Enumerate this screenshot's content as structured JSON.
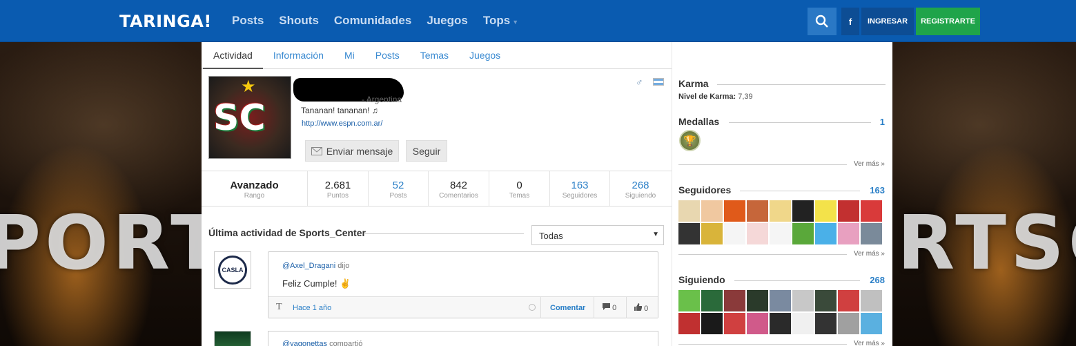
{
  "header": {
    "logo": "TARINGA!",
    "nav": [
      "Posts",
      "Shouts",
      "Comunidades",
      "Juegos",
      "Tops"
    ],
    "facebook_label": "f",
    "login_label": "INGRESAR",
    "register_label": "REGISTRARTE",
    "colors": {
      "bar": "#0a5bb0",
      "register": "#1fa44a"
    }
  },
  "background": {
    "text_left": "PORTS",
    "text_right": "RTSC"
  },
  "profile": {
    "tabs": [
      "Actividad",
      "Información",
      "Mi",
      "Posts",
      "Temas",
      "Juegos"
    ],
    "active_tab": "Actividad",
    "avatar_text": "SC",
    "country": "- Argentina",
    "bio": "Tananan! tananan! ♫",
    "link": "http://www.espn.com.ar/",
    "send_message_label": "Enviar mensaje",
    "follow_label": "Seguir"
  },
  "stats": [
    {
      "value": "Avanzado",
      "label": "Rango"
    },
    {
      "value": "2.681",
      "label": "Puntos"
    },
    {
      "value": "52",
      "label": "Posts"
    },
    {
      "value": "842",
      "label": "Comentarios"
    },
    {
      "value": "0",
      "label": "Temas"
    },
    {
      "value": "163",
      "label": "Seguidores"
    },
    {
      "value": "268",
      "label": "Siguiendo"
    }
  ],
  "activity": {
    "title": "Última actividad de Sports_Center",
    "filter": "Todas",
    "posts": [
      {
        "author": "@Axel_Dragani",
        "verb": "dijo",
        "message": "Feliz Cumple! ✌",
        "avatar_text": "CASLA",
        "time": "Hace 1 año",
        "comment_label": "Comentar",
        "comments": "0",
        "likes": "0"
      },
      {
        "author": "@yagonettas",
        "verb": "compartió"
      }
    ]
  },
  "sidebar": {
    "karma": {
      "title": "Karma",
      "level_label": "Nivel de Karma:",
      "level_value": "7,39"
    },
    "medals": {
      "title": "Medallas",
      "count": "1",
      "more": "Ver más »"
    },
    "followers": {
      "title": "Seguidores",
      "count": "163",
      "more": "Ver más »"
    },
    "following": {
      "title": "Siguiendo",
      "count": "268",
      "more": "Ver más »"
    }
  },
  "follower_colors": [
    "#e8d7b0",
    "#f0c8a0",
    "#e05a1a",
    "#c6663a",
    "#f0d78a",
    "#222222",
    "#f3e24a",
    "#c23030",
    "#d93a3a",
    "#333333",
    "#d9b43a",
    "#f5f5f5",
    "#f5d8d8",
    "#f5f5f5",
    "#5aa83a",
    "#4ab0e8",
    "#e8a0c0",
    "#7a8a9a"
  ],
  "following_colors": [
    "#6ac04a",
    "#2a6a3a",
    "#8a3a3a",
    "#2a3a2a",
    "#7a8aa0",
    "#c8c8c8",
    "#3a4a3a",
    "#d04040",
    "#c0c0c0",
    "#c03030",
    "#1a1a1a",
    "#d04040",
    "#d05a8a",
    "#2a2a2a",
    "#f0f0f0",
    "#333333",
    "#a0a0a0",
    "#5ab0e0"
  ]
}
